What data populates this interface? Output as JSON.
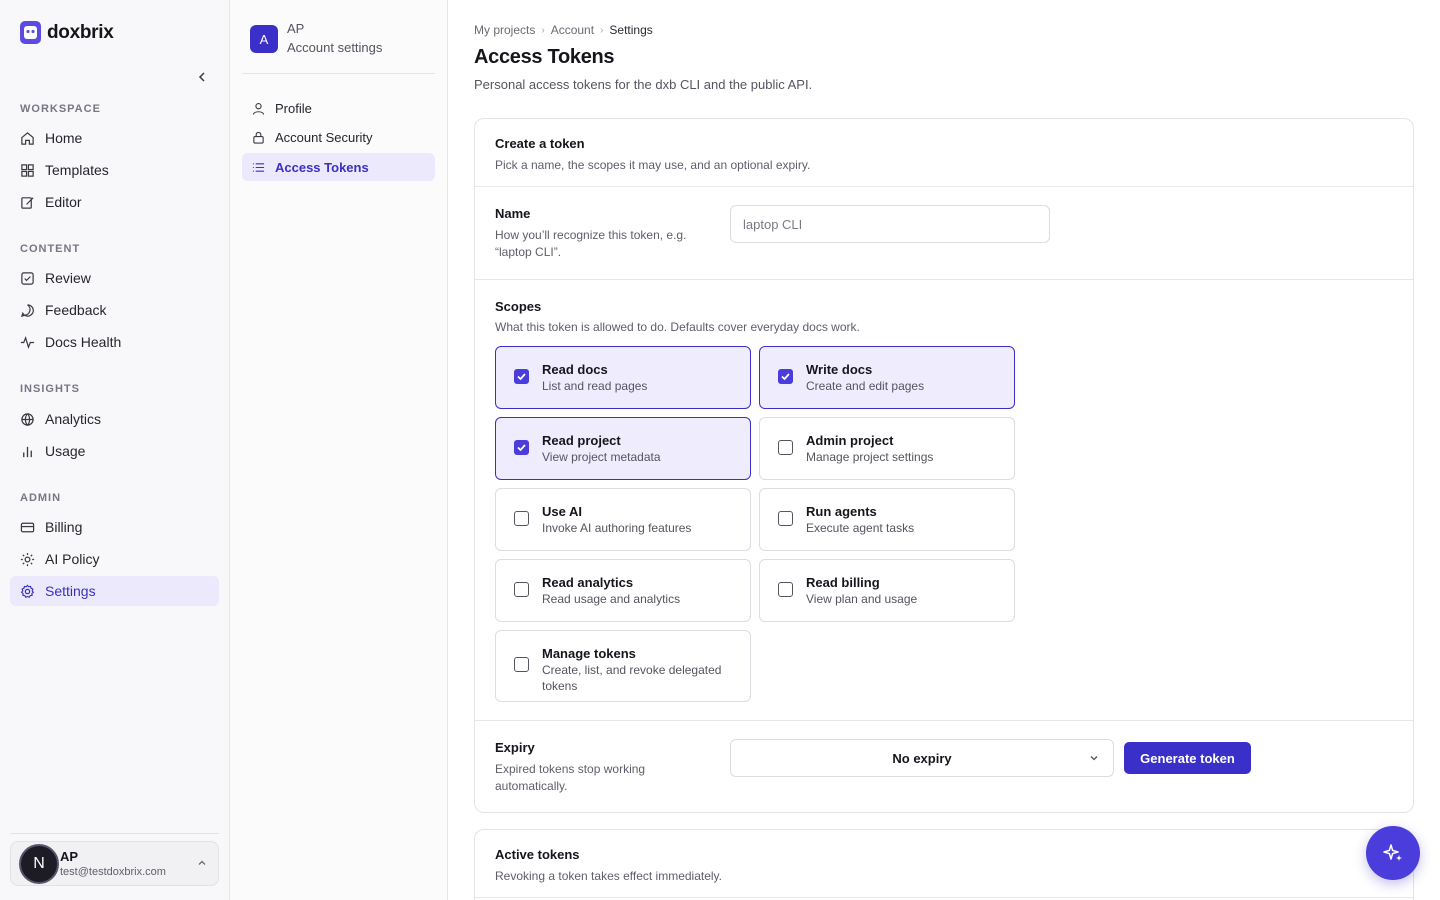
{
  "app": {
    "name": "doxbrix",
    "accent": "#3b2fc9"
  },
  "sidebar": {
    "sections": [
      {
        "label": "WORKSPACE"
      },
      {
        "label": "CONTENT"
      },
      {
        "label": "INSIGHTS"
      },
      {
        "label": "ADMIN"
      }
    ],
    "items": [
      {
        "label": "Home",
        "icon": "home-icon"
      },
      {
        "label": "Templates",
        "icon": "grid-icon"
      },
      {
        "label": "Editor",
        "icon": "edit-icon"
      },
      {
        "label": "Review",
        "icon": "check-square-icon"
      },
      {
        "label": "Feedback",
        "icon": "message-icon"
      },
      {
        "label": "Docs Health",
        "icon": "activity-icon"
      },
      {
        "label": "Analytics",
        "icon": "globe-icon"
      },
      {
        "label": "Usage",
        "icon": "bar-chart-icon"
      },
      {
        "label": "Billing",
        "icon": "credit-card-icon"
      },
      {
        "label": "AI Policy",
        "icon": "sparkle-icon"
      },
      {
        "label": "Settings",
        "icon": "gear-icon",
        "active": true
      }
    ],
    "user": {
      "initial": "N",
      "name": "AP",
      "email": "test@testdoxbrix.com"
    }
  },
  "subnav": {
    "badge": "A",
    "initials": "AP",
    "title": "Account settings",
    "items": [
      {
        "label": "Profile",
        "icon": "user-icon"
      },
      {
        "label": "Account Security",
        "icon": "lock-icon"
      },
      {
        "label": "Access Tokens",
        "icon": "list-icon",
        "active": true
      }
    ]
  },
  "main": {
    "breadcrumb": [
      "My projects",
      "Account",
      "Settings"
    ],
    "title": "Access Tokens",
    "subtitle": "Personal access tokens for the dxb CLI and the public API.",
    "create": {
      "title": "Create a token",
      "desc": "Pick a name, the scopes it may use, and an optional expiry.",
      "name_label": "Name",
      "name_help": "How you’ll recognize this token, e.g. “laptop CLI”.",
      "name_placeholder": "laptop CLI",
      "scopes_label": "Scopes",
      "scopes_help": "What this token is allowed to do. Defaults cover everyday docs work.",
      "scopes": [
        {
          "name": "Read docs",
          "desc": "List and read pages",
          "checked": true
        },
        {
          "name": "Write docs",
          "desc": "Create and edit pages",
          "checked": true
        },
        {
          "name": "Read project",
          "desc": "View project metadata",
          "checked": true
        },
        {
          "name": "Admin project",
          "desc": "Manage project settings",
          "checked": false
        },
        {
          "name": "Use AI",
          "desc": "Invoke AI authoring features",
          "checked": false
        },
        {
          "name": "Run agents",
          "desc": "Execute agent tasks",
          "checked": false
        },
        {
          "name": "Read analytics",
          "desc": "Read usage and analytics",
          "checked": false
        },
        {
          "name": "Read billing",
          "desc": "View plan and usage",
          "checked": false
        },
        {
          "name": "Manage tokens",
          "desc": "Create, list, and revoke delegated tokens",
          "checked": false
        }
      ],
      "expiry_label": "Expiry",
      "expiry_help": "Expired tokens stop working automatically.",
      "expiry_value": "No expiry",
      "generate_label": "Generate token"
    },
    "active": {
      "title": "Active tokens",
      "desc": "Revoking a token takes effect immediately."
    }
  }
}
